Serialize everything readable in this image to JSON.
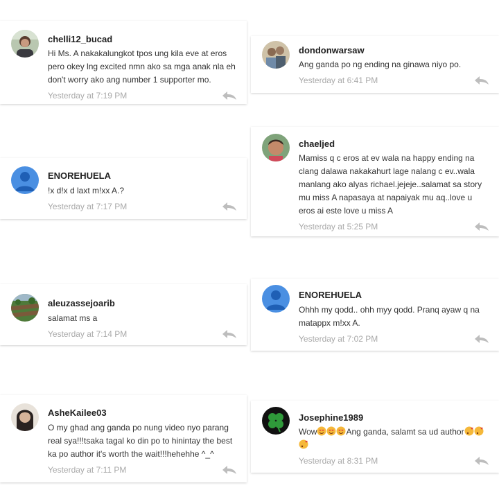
{
  "icons": {
    "reply": "reply-arrow-icon",
    "default_avatar": "person-icon"
  },
  "colors": {
    "time": "#a9a9a9",
    "default_avatar_bg": "#4a8fe2",
    "reply_icon": "#bdbdbd"
  },
  "comments": [
    {
      "username": "chelli12_bucad",
      "lines": [
        "Hi Ms. A nakakalungkot tpos ung kila eve at eros",
        "pero okey lng excited nmn ako sa mga anak nla eh",
        "don't worry ako ang number 1 supporter mo."
      ],
      "time": "Yesterday at 7:19 PM"
    },
    {
      "username": "dondonwarsaw",
      "lines": [
        "Ang ganda po ng ending na ginawa niyo po."
      ],
      "time": "Yesterday at 6:41 PM"
    },
    {
      "username": "ENOREHUELA",
      "lines": [
        "!x d!x d laxt m!xx A.?"
      ],
      "time": "Yesterday at 7:17 PM"
    },
    {
      "username": "chaeljed",
      "lines": [
        "Mamiss q c eros at ev wala na happy ending na",
        "clang dalawa nakakahurt lage nalang c ev..wala",
        "manlang ako alyas richael.jejeje..salamat sa story",
        "mu miss A napasaya at napaiyak mu aq..love u",
        "eros ai este love u miss A"
      ],
      "time": "Yesterday at 5:25 PM"
    },
    {
      "username": "aleuzassejoarib",
      "lines": [
        "salamat ms a"
      ],
      "time": "Yesterday at 7:14 PM"
    },
    {
      "username": "ENOREHUELA",
      "lines": [
        "Ohhh my qodd.. ohh myy qodd. Pranq ayaw q na",
        "matappx m!xx A."
      ],
      "time": "Yesterday at 7:02 PM"
    },
    {
      "username": "AsheKailee03",
      "lines": [
        "O my ghad ang ganda po nung video nyo parang",
        "real sya!!!tsaka tagal ko din po to hinintay the best",
        "ka po author it's worth the wait!!!hehehhe ^_^"
      ],
      "time": "Yesterday at 7:11 PM"
    },
    {
      "username": "Josephine1989",
      "text_prefix": "Wow",
      "text_middle": "Ang ganda, salamt sa ud author",
      "time": "Yesterday at 8:31 PM"
    }
  ]
}
